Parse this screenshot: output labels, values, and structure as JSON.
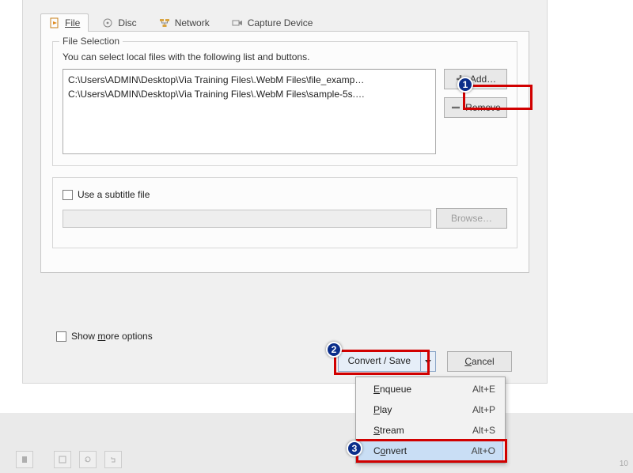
{
  "tabs": {
    "file": "File",
    "disc": "Disc",
    "network": "Network",
    "capture": "Capture Device"
  },
  "file_selection": {
    "legend": "File Selection",
    "hint": "You can select local files with the following list and buttons.",
    "items": [
      "C:\\Users\\ADMIN\\Desktop\\Via Training Files\\.WebM Files\\file_examp…",
      "C:\\Users\\ADMIN\\Desktop\\Via Training Files\\.WebM Files\\sample-5s.…"
    ],
    "add_label": "Add…",
    "remove_label": "Remove"
  },
  "subtitle": {
    "checkbox_label": "Use a subtitle file",
    "browse_label": "Browse…"
  },
  "show_more_label": "Show more options",
  "convert_save_label": "Convert / Save",
  "cancel_label": "Cancel",
  "menu": {
    "enqueue": {
      "label": "Enqueue",
      "shortcut": "Alt+E"
    },
    "play": {
      "label": "Play",
      "shortcut": "Alt+P"
    },
    "stream": {
      "label": "Stream",
      "shortcut": "Alt+S"
    },
    "convert": {
      "label": "Convert",
      "shortcut": "Alt+O"
    }
  },
  "annotations": {
    "b1": "1",
    "b2": "2",
    "b3": "3"
  },
  "page_number": "10"
}
